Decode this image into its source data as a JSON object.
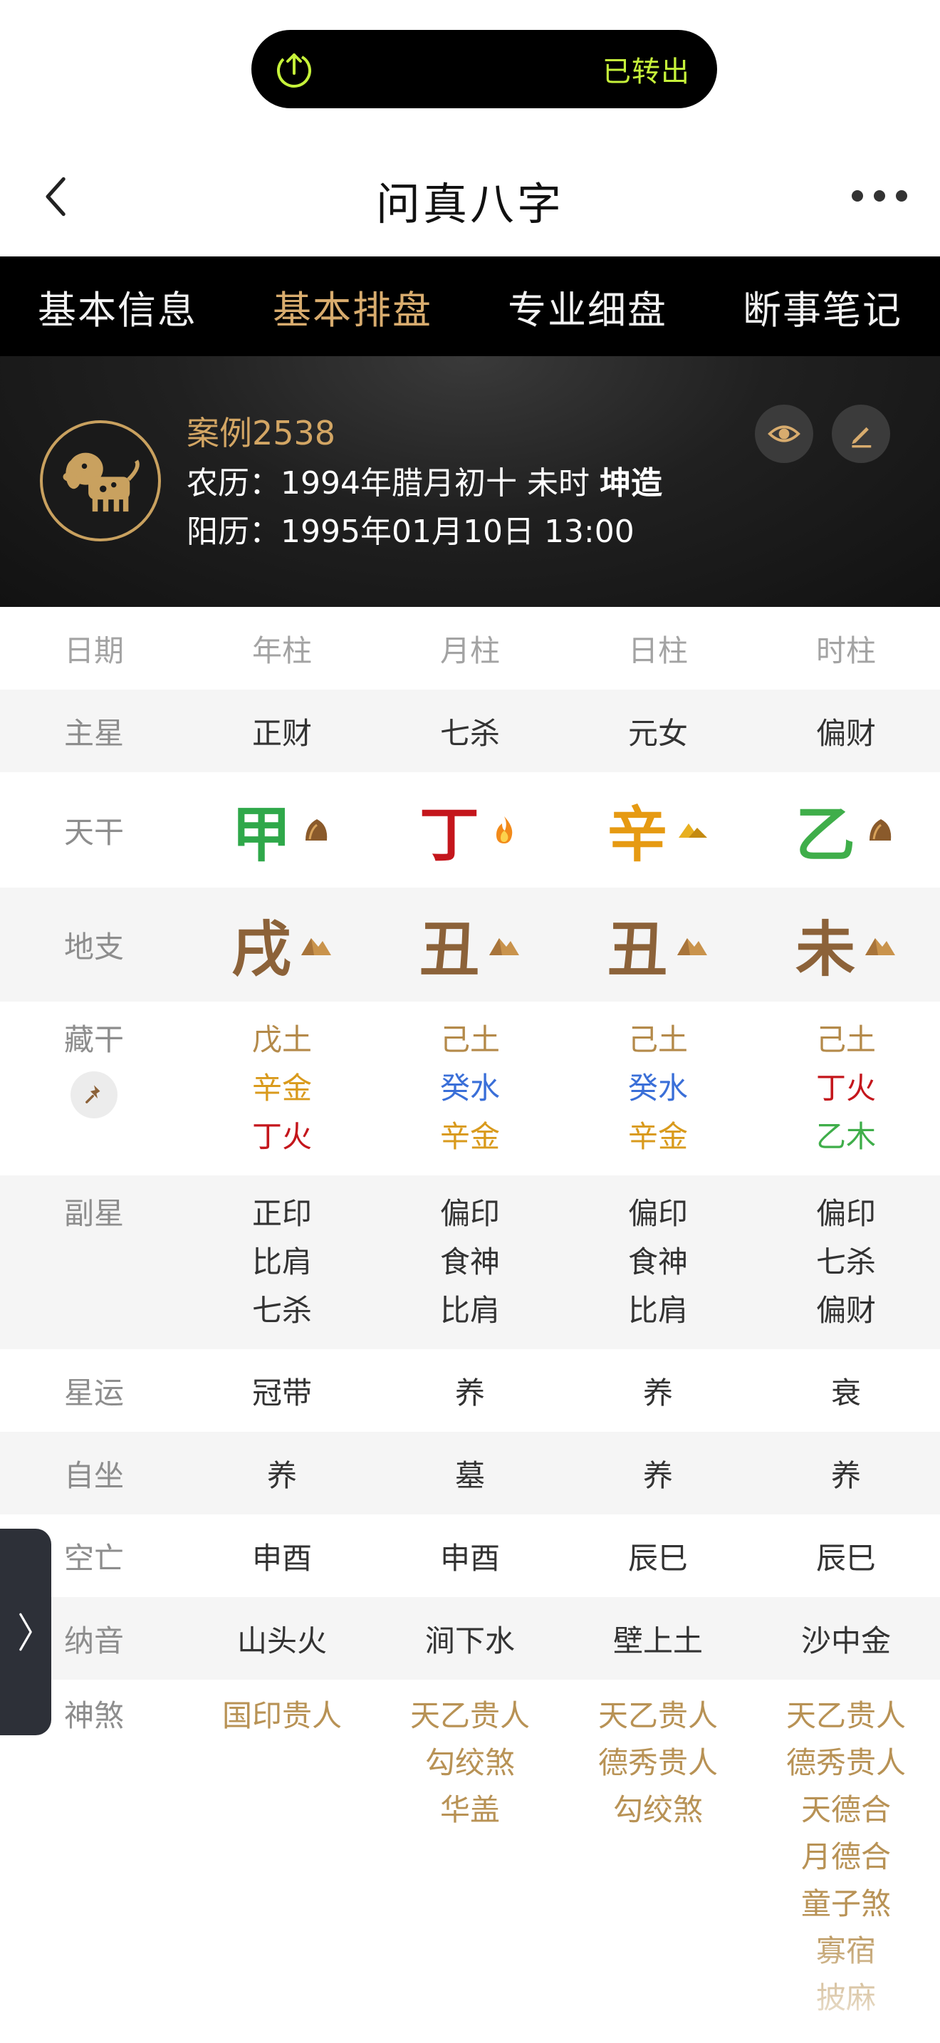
{
  "status_pill": {
    "label": "已转出",
    "icon": "share-upload-icon",
    "accent": "#c6f23a"
  },
  "nav": {
    "title": "问真八字",
    "back_icon": "chevron-left-icon",
    "more_icon": "more-dots-icon"
  },
  "tabs": [
    {
      "label": "基本信息",
      "active": false
    },
    {
      "label": "基本排盘",
      "active": true
    },
    {
      "label": "专业细盘",
      "active": false
    },
    {
      "label": "断事笔记",
      "active": false
    }
  ],
  "profile": {
    "name": "案例2538",
    "lunar_prefix": "农历：",
    "lunar": "1994年腊月初十 未时",
    "gender": "坤造",
    "solar_prefix": "阳历：",
    "solar": "1995年01月10日 13:00",
    "avatar_icon": "dog-zodiac-icon",
    "actions": [
      "eye-icon",
      "edit-pencil-icon"
    ]
  },
  "chart": {
    "headers": [
      "日期",
      "年柱",
      "月柱",
      "日柱",
      "时柱"
    ],
    "main_star": {
      "label": "主星",
      "values": [
        "正财",
        "七杀",
        "元女",
        "偏财"
      ]
    },
    "tiangan": {
      "label": "天干",
      "values": [
        {
          "char": "甲",
          "color": "#2fa84a",
          "icon": "wood-icon"
        },
        {
          "char": "丁",
          "color": "#c4161c",
          "icon": "fire-icon"
        },
        {
          "char": "辛",
          "color": "#e69a12",
          "icon": "metal-icon"
        },
        {
          "char": "乙",
          "color": "#3fae4a",
          "icon": "wood-icon"
        }
      ]
    },
    "dizhi": {
      "label": "地支",
      "values": [
        {
          "char": "戌",
          "color": "#8c6239",
          "icon": "earth-icon"
        },
        {
          "char": "丑",
          "color": "#8c6239",
          "icon": "earth-icon"
        },
        {
          "char": "丑",
          "color": "#8c6239",
          "icon": "earth-icon"
        },
        {
          "char": "未",
          "color": "#8c6239",
          "icon": "earth-icon"
        }
      ]
    },
    "canggan": {
      "label": "藏干",
      "values": [
        [
          {
            "t": "戊土",
            "c": "#b48a4a"
          },
          {
            "t": "辛金",
            "c": "#d99a1c"
          },
          {
            "t": "丁火",
            "c": "#c4161c"
          }
        ],
        [
          {
            "t": "己土",
            "c": "#b48a4a"
          },
          {
            "t": "癸水",
            "c": "#3a6fd8"
          },
          {
            "t": "辛金",
            "c": "#d99a1c"
          }
        ],
        [
          {
            "t": "己土",
            "c": "#b48a4a"
          },
          {
            "t": "癸水",
            "c": "#3a6fd8"
          },
          {
            "t": "辛金",
            "c": "#d99a1c"
          }
        ],
        [
          {
            "t": "己土",
            "c": "#b48a4a"
          },
          {
            "t": "丁火",
            "c": "#c4161c"
          },
          {
            "t": "乙木",
            "c": "#3fae4a"
          }
        ]
      ]
    },
    "fuxing": {
      "label": "副星",
      "values": [
        [
          "正印",
          "比肩",
          "七杀"
        ],
        [
          "偏印",
          "食神",
          "比肩"
        ],
        [
          "偏印",
          "食神",
          "比肩"
        ],
        [
          "偏印",
          "七杀",
          "偏财"
        ]
      ]
    },
    "xingyun": {
      "label": "星运",
      "values": [
        "冠带",
        "养",
        "养",
        "衰"
      ]
    },
    "zizuo": {
      "label": "自坐",
      "values": [
        "养",
        "墓",
        "养",
        "养"
      ]
    },
    "kongwang": {
      "label": "空亡",
      "values": [
        "申酉",
        "申酉",
        "辰巳",
        "辰巳"
      ]
    },
    "nayin": {
      "label": "纳音",
      "values": [
        "山头火",
        "涧下水",
        "壁上土",
        "沙中金"
      ]
    },
    "shensha": {
      "label": "神煞",
      "values": [
        [
          "国印贵人"
        ],
        [
          "天乙贵人",
          "勾绞煞",
          "华盖"
        ],
        [
          "天乙贵人",
          "德秀贵人",
          "勾绞煞"
        ],
        [
          "天乙贵人",
          "德秀贵人",
          "天德合",
          "月德合",
          "童子煞",
          "寡宿",
          "披麻"
        ]
      ]
    }
  },
  "side_handle_icon": "chevron-right-icon"
}
